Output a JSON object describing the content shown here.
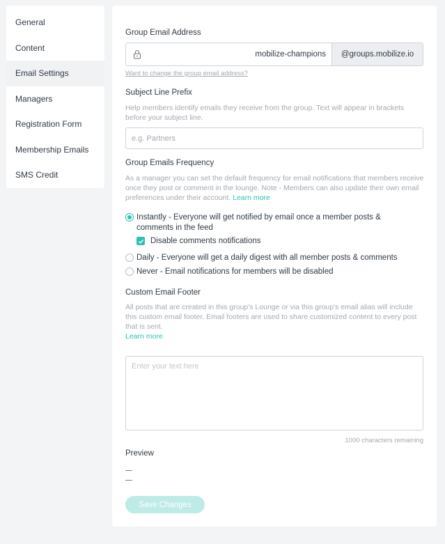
{
  "sidebar": {
    "items": [
      {
        "label": "General",
        "active": false
      },
      {
        "label": "Content",
        "active": false
      },
      {
        "label": "Email Settings",
        "active": true
      },
      {
        "label": "Managers",
        "active": false
      },
      {
        "label": "Registration Form",
        "active": false
      },
      {
        "label": "Membership Emails",
        "active": false
      },
      {
        "label": "SMS Credit",
        "active": false
      }
    ]
  },
  "group_email": {
    "label": "Group Email Address",
    "value": "mobilize-champions",
    "suffix": "@groups.mobilize.io",
    "change_link": "Want to change the group email address?",
    "icon": "lock-icon"
  },
  "subject_prefix": {
    "label": "Subject Line Prefix",
    "help": "Help members identify emails they receive from the group. Text will appear in brackets before your subject line.",
    "placeholder": "e.g. Partners"
  },
  "frequency": {
    "label": "Group Emails Frequency",
    "help": "As a manager you can set the default frequency for email notifications that members receive once they post or comment in the lounge. Note - Members can also update their own email preferences under their account.",
    "learn_more": "Learn more",
    "options": [
      {
        "label": "Instantly - Everyone will get notified by email once a member posts & comments in the feed",
        "checked": true
      },
      {
        "label": "Daily - Everyone will get a daily digest with all member posts & comments",
        "checked": false
      },
      {
        "label": "Never - Email notifications for members will be disabled",
        "checked": false
      }
    ],
    "disable_comments_label": "Disable comments notifications",
    "disable_comments_checked": true
  },
  "footer": {
    "label": "Custom Email Footer",
    "help": "All posts that are created in this group's Lounge or via this group's email alias will include this custom email footer. Email footers are used to share customized content to every post that is sent.",
    "learn_more": "Learn more",
    "placeholder": "Enter your text here",
    "chars_remaining": "1000 characters remaining"
  },
  "preview": {
    "label": "Preview"
  },
  "save_label": "Save Changes",
  "colors": {
    "accent": "#2cc0b4",
    "save_disabled": "#bdebe6"
  }
}
